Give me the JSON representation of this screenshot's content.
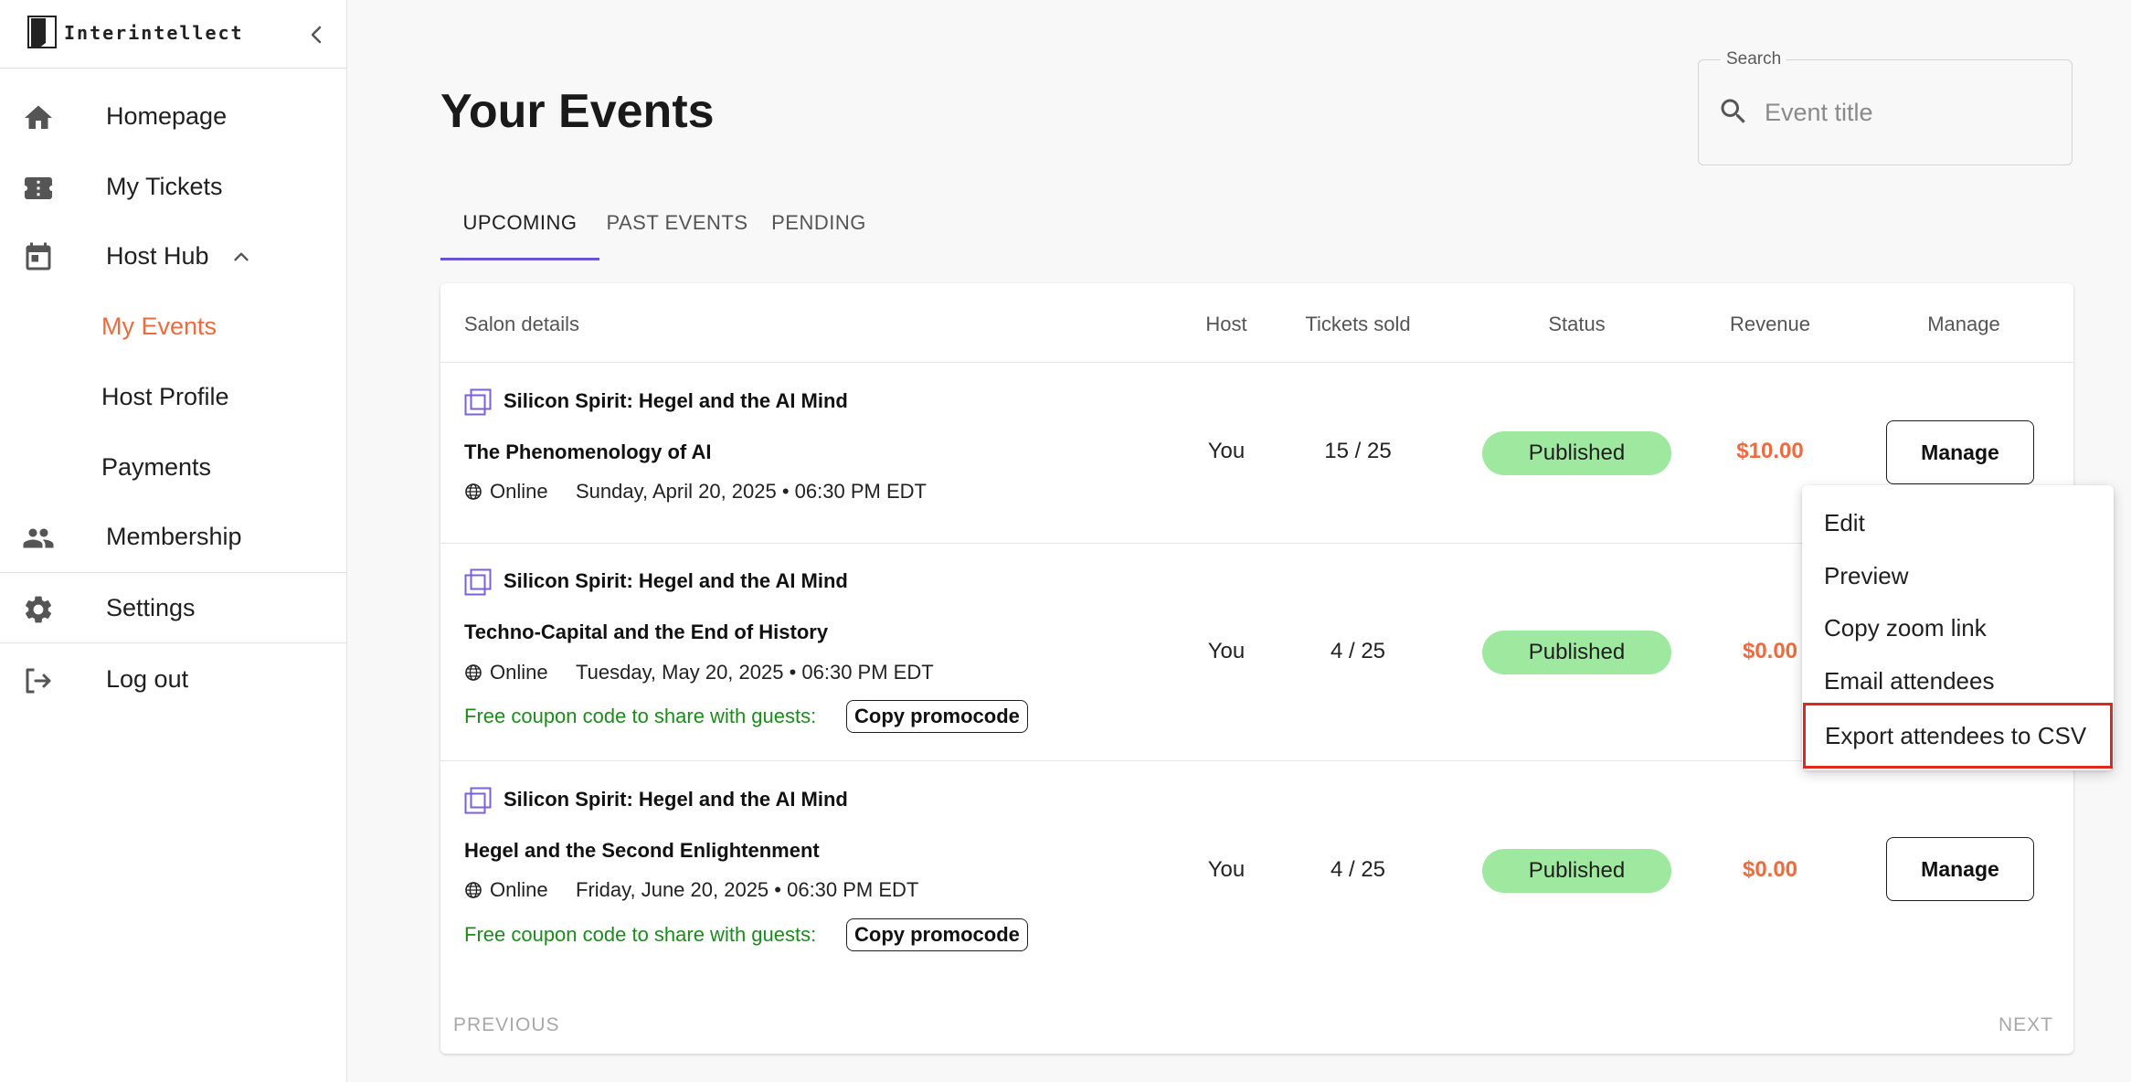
{
  "brand": {
    "name": "Interintellect"
  },
  "sidebar": {
    "items": [
      {
        "label": "Homepage",
        "icon": "home-icon"
      },
      {
        "label": "My Tickets",
        "icon": "ticket-icon"
      },
      {
        "label": "Host Hub",
        "icon": "calendar-icon",
        "expanded": true
      },
      {
        "label": "Membership",
        "icon": "people-icon"
      },
      {
        "label": "Settings",
        "icon": "gear-icon"
      },
      {
        "label": "Log out",
        "icon": "logout-icon"
      }
    ],
    "host_hub_sub": [
      {
        "label": "My Events",
        "active": true
      },
      {
        "label": "Host Profile"
      },
      {
        "label": "Payments"
      }
    ]
  },
  "page": {
    "title": "Your Events"
  },
  "search": {
    "legend": "Search",
    "placeholder": "Event title",
    "value": ""
  },
  "tabs": [
    {
      "label": "UPCOMING",
      "active": true
    },
    {
      "label": "PAST EVENTS"
    },
    {
      "label": "PENDING"
    }
  ],
  "table": {
    "headers": [
      "Salon details",
      "Host",
      "Tickets sold",
      "Status",
      "Revenue",
      "Manage"
    ],
    "rows": [
      {
        "series": "Silicon Spirit: Hegel and the AI Mind",
        "title": "The Phenomenology of AI",
        "location": "Online",
        "date": "Sunday, April 20, 2025 • 06:30 PM EDT",
        "coupon": "",
        "host": "You",
        "tickets": "15 / 25",
        "status": "Published",
        "revenue": "$10.00",
        "manage": "Manage"
      },
      {
        "series": "Silicon Spirit: Hegel and the AI Mind",
        "title": "Techno-Capital and the End of History",
        "location": "Online",
        "date": "Tuesday, May 20, 2025 • 06:30 PM EDT",
        "coupon": "Free coupon code to share with guests:",
        "promo_button": "Copy promocode",
        "host": "You",
        "tickets": "4 / 25",
        "status": "Published",
        "revenue": "$0.00",
        "manage": "Manage"
      },
      {
        "series": "Silicon Spirit: Hegel and the AI Mind",
        "title": "Hegel and the Second Enlightenment",
        "location": "Online",
        "date": "Friday, June 20, 2025 • 06:30 PM EDT",
        "coupon": "Free coupon code to share with guests:",
        "promo_button": "Copy promocode",
        "host": "You",
        "tickets": "4 / 25",
        "status": "Published",
        "revenue": "$0.00",
        "manage": "Manage"
      }
    ]
  },
  "pagination": {
    "previous": "PREVIOUS",
    "next": "NEXT"
  },
  "manage_menu": {
    "items": [
      "Edit",
      "Preview",
      "Copy zoom link",
      "Email attendees",
      "Export attendees to CSV"
    ],
    "highlighted": "Export attendees to CSV"
  },
  "colors": {
    "accent_orange": "#ec6b3f",
    "tab_indicator": "#6b52d9",
    "status_green": "#9ee8a0",
    "coupon_green": "#1e8a1e",
    "highlight_red": "#e0281c"
  }
}
